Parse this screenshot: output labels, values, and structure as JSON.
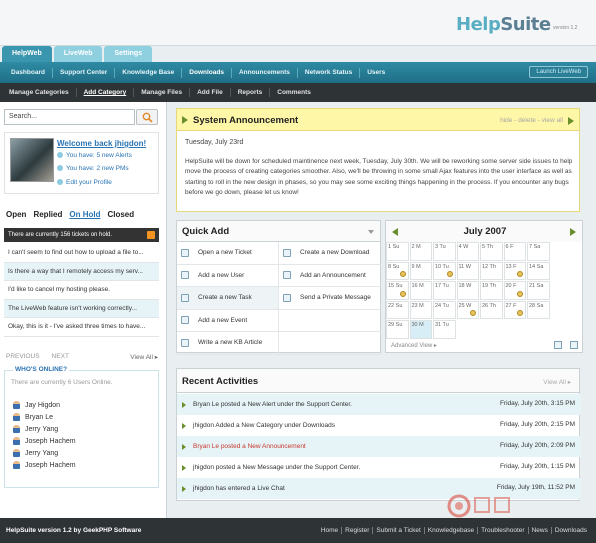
{
  "brand": {
    "name_part1": "Help",
    "name_part2": "Suite",
    "version": "version 1.2"
  },
  "tabs": [
    {
      "label": "HelpWeb"
    },
    {
      "label": "LiveWeb"
    },
    {
      "label": "Settings"
    }
  ],
  "nav_primary": [
    "Dashboard",
    "Support Center",
    "Knowledge Base",
    "Downloads",
    "Announcements",
    "Network Status",
    "Users"
  ],
  "launch_button": "Launch LiveWeb",
  "nav_secondary": [
    "Manage Categories",
    "Add Category",
    "Manage Files",
    "Add File",
    "Reports",
    "Comments"
  ],
  "search": {
    "value": "Search..."
  },
  "welcome": {
    "title": "Welcome back jhigdon!",
    "alerts": "You have: 5 new Alerts",
    "pms": "You have: 2 new PMs",
    "edit": "Edit your Profile"
  },
  "ticket_tabs": [
    "Open",
    "Replied",
    "On Hold",
    "Closed"
  ],
  "onhold_text": "There are currently 156 tickets on hold.",
  "tickets": [
    "I can't seem to find out how to upload a file to...",
    "Is there a way that I remotely access my serv...",
    "I'd like to cancel my hosting please.",
    "The LiveWeb feature isn't working correctly...",
    "Okay, this is it - I've asked three times to have..."
  ],
  "pager": {
    "prev": "PREVIOUS",
    "next": "NEXT",
    "view_all": "View All ▸"
  },
  "whos_online": {
    "title": "WHO'S ONLINE?",
    "subtitle": "There are currently 6 Users Online.",
    "users": [
      "Jay Higdon",
      "Bryan Le",
      "Jerry Yang",
      "Joseph Hachem",
      "Jerry Yang",
      "Joseph Hachem"
    ]
  },
  "announcement": {
    "title": "System Announcement",
    "actions": "hide - delete - view all",
    "date": "Tuesday, July 23rd",
    "body": "HelpSuite will be down for scheduled maintinence next week, Tuesday, July 30th.  We will be reworking some server side issues to help move the process of creating categories smoother.  Also, we'll be throwing in some small Ajax features into the user interface as well as starting to roll in the new design in phases, so you may see some exciting things happening in the process.  If you encounter any bugs before we go down, please let us know!"
  },
  "quick_add": {
    "title": "Quick Add",
    "items": [
      "Open a new Ticket",
      "Create a new Download",
      "Add a new User",
      "Add an Announcement",
      "Create a new Task",
      "Send a Private Message",
      "Add a new Event",
      "",
      "Write a new KB Article",
      ""
    ]
  },
  "calendar": {
    "title": "July 2007",
    "advanced": "Advanced View ▸",
    "cells": [
      "1 Su",
      "2 M",
      "3 Tu",
      "4 W",
      "5 Th",
      "6 F",
      "7 Sa",
      "8 Su",
      "9 M",
      "10 Tu",
      "11 W",
      "12 Th",
      "13 F",
      "14 Sa",
      "15 Su",
      "16 M",
      "17 Tu",
      "18 W",
      "19 Th",
      "20 F",
      "21 Sa",
      "22 Su",
      "23 M",
      "24 Tu",
      "25 W",
      "26 Th",
      "27 F",
      "28 Sa",
      "29 Su",
      "30 M",
      "31 Tu",
      "",
      "",
      "",
      ""
    ],
    "events": [
      7,
      9,
      12,
      14,
      19,
      24,
      26
    ],
    "today": 29
  },
  "recent": {
    "title": "Recent Activities",
    "view_all": "View All ▸",
    "rows": [
      {
        "text": "Bryan Le posted a New Alert under the Support Center.",
        "date": "Friday, July 20th, 3:15 PM",
        "red": false
      },
      {
        "text": "jhigdon Added a New Category under Downloads",
        "date": "Friday, July 20th, 2:15 PM",
        "red": false
      },
      {
        "text": "Bryan Le posted a New Announcement",
        "date": "Friday, July 20th, 2:09 PM",
        "red": true
      },
      {
        "text": "jhigdon posted a New Message under the Support Center.",
        "date": "Friday, July 20th, 1:15 PM",
        "red": false
      },
      {
        "text": "jhigdon has entered a Live Chat",
        "date": "Friday, July 19th, 11:52 PM",
        "red": false
      }
    ]
  },
  "footer": {
    "copy": "HelpSuite version 1.2 by GeekPHP Software",
    "links": [
      "Home",
      "Register",
      "Submit a Ticket",
      "Knowledgebase",
      "Troubleshooter",
      "News",
      "Downloads"
    ]
  },
  "colors": {
    "accent": "#2f8aa4",
    "link": "#2a74b3",
    "announce_bg": "#fff7a8",
    "alert_red": "#c8362b"
  }
}
